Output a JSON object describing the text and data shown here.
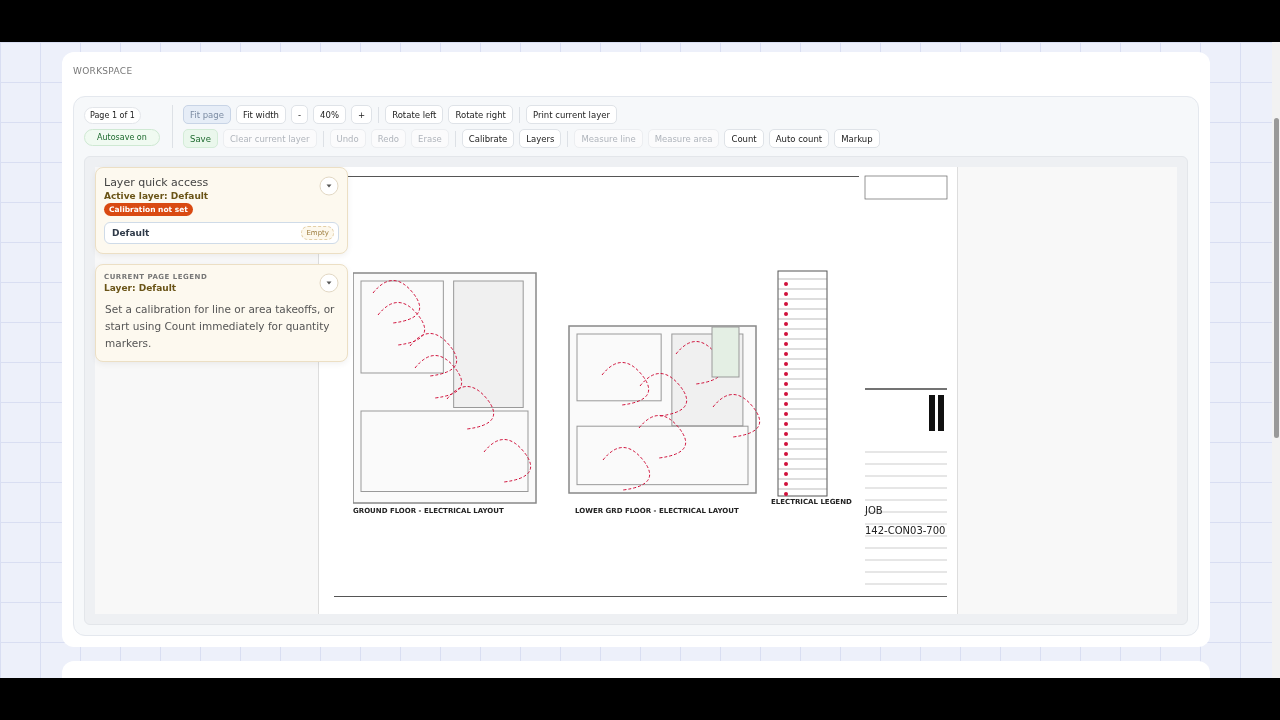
{
  "section_title": "WORKSPACE",
  "page_indicator": "Page 1 of 1",
  "autosave": "Autosave on",
  "toolbar_rows": [
    {
      "groups": [
        [
          {
            "label": "Fit page",
            "kind": "default",
            "selected": true,
            "disabled": false
          },
          {
            "label": "Fit width",
            "kind": "default",
            "selected": false,
            "disabled": false
          },
          {
            "label": "-",
            "kind": "default",
            "selected": false,
            "disabled": false
          },
          {
            "label": "40%",
            "kind": "default",
            "selected": false,
            "disabled": false
          },
          {
            "label": "+",
            "kind": "default",
            "selected": false,
            "disabled": false
          }
        ],
        [
          {
            "label": "Rotate left",
            "kind": "default",
            "selected": false,
            "disabled": false
          },
          {
            "label": "Rotate right",
            "kind": "default",
            "selected": false,
            "disabled": false
          }
        ],
        [
          {
            "label": "Print current layer",
            "kind": "default",
            "selected": false,
            "disabled": false
          }
        ]
      ]
    },
    {
      "groups": [
        [
          {
            "label": "Save",
            "kind": "success",
            "selected": false,
            "disabled": false
          },
          {
            "label": "Clear current layer",
            "kind": "default",
            "selected": false,
            "disabled": true
          }
        ],
        [
          {
            "label": "Undo",
            "kind": "default",
            "selected": false,
            "disabled": true
          },
          {
            "label": "Redo",
            "kind": "default",
            "selected": false,
            "disabled": true
          },
          {
            "label": "Erase",
            "kind": "default",
            "selected": false,
            "disabled": true
          }
        ],
        [
          {
            "label": "Calibrate",
            "kind": "default",
            "selected": false,
            "disabled": false
          },
          {
            "label": "Layers",
            "kind": "default",
            "selected": false,
            "disabled": false
          }
        ],
        [
          {
            "label": "Measure line",
            "kind": "default",
            "selected": false,
            "disabled": true
          },
          {
            "label": "Measure area",
            "kind": "default",
            "selected": false,
            "disabled": true
          },
          {
            "label": "Count",
            "kind": "default",
            "selected": false,
            "disabled": false
          },
          {
            "label": "Auto count",
            "kind": "default",
            "selected": false,
            "disabled": false
          },
          {
            "label": "Markup",
            "kind": "default",
            "selected": false,
            "disabled": false
          }
        ]
      ]
    }
  ],
  "layer_card": {
    "title": "Layer quick access",
    "active_layer": "Active layer: Default",
    "badge": "Calibration not set",
    "layers": [
      {
        "name": "Default",
        "status": "Empty"
      }
    ]
  },
  "legend_card": {
    "label": "CURRENT PAGE LEGEND",
    "layer": "Layer: Default",
    "text": "Set a calibration for line or area takeoffs, or start using Count immediately for quantity markers."
  },
  "sheet": {
    "plans": [
      {
        "title": "GROUND FLOOR - ELECTRICAL LAYOUT"
      },
      {
        "title": "LOWER GRD FLOOR - ELECTRICAL LAYOUT"
      }
    ],
    "legend_title": "ELECTRICAL LEGEND",
    "title_block": {
      "job_label": "JOB",
      "drawing_number": "142-CON03-700"
    }
  }
}
